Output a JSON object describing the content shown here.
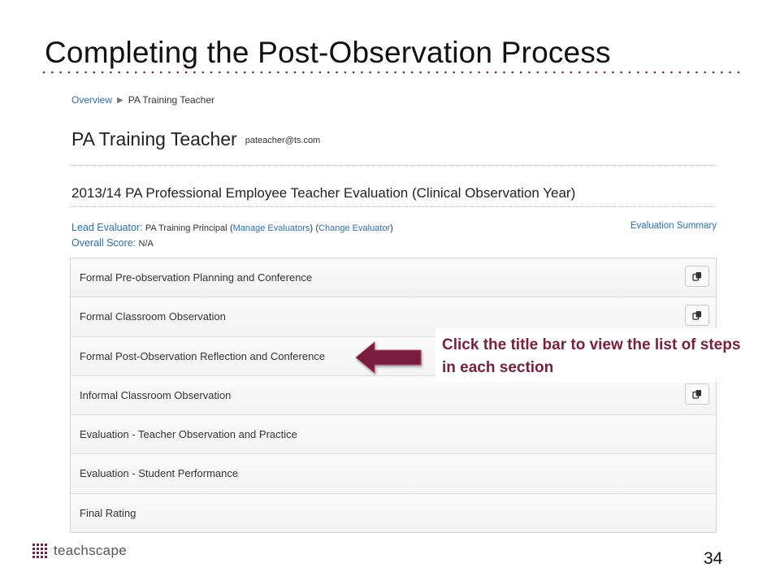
{
  "slide": {
    "title": "Completing the Post-Observation Process",
    "page_number": "34",
    "logo_text": "teachscape",
    "accent_color": "#7a1f3d"
  },
  "breadcrumb": {
    "root": "Overview",
    "current": "PA Training Teacher"
  },
  "teacher": {
    "name": "PA Training Teacher",
    "email": "pateacher@ts.com"
  },
  "evaluation": {
    "title": "2013/14 PA Professional Employee Teacher Evaluation (Clinical Observation Year)",
    "lead_evaluator_label": "Lead Evaluator:",
    "lead_evaluator_value": "PA Training Principal",
    "paren_open_1": "(",
    "manage_evaluators": "Manage Evaluators",
    "paren_close_1": ")",
    "paren_open_2": "(",
    "change_evaluator": "Change Evaluator",
    "paren_close_2": ")",
    "overall_score_label": "Overall Score:",
    "overall_score_value": "N/A",
    "summary_link": "Evaluation Summary"
  },
  "sections": [
    {
      "label": "Formal Pre-observation Planning and Conference",
      "has_copy_icon": true
    },
    {
      "label": "Formal Classroom Observation",
      "has_copy_icon": true
    },
    {
      "label": "Formal Post-Observation Reflection and Conference",
      "has_copy_icon": false
    },
    {
      "label": "Informal Classroom Observation",
      "has_copy_icon": true
    },
    {
      "label": "Evaluation - Teacher Observation and Practice",
      "has_copy_icon": false
    },
    {
      "label": "Evaluation - Student Performance",
      "has_copy_icon": false
    },
    {
      "label": "Final Rating",
      "has_copy_icon": false
    }
  ],
  "callout": {
    "text": "Click the title bar to view the list of steps in each section"
  },
  "icons": {
    "copy": "copy-icon",
    "arrow": "left-arrow-icon",
    "breadcrumb_separator": "triangle-right-icon"
  }
}
